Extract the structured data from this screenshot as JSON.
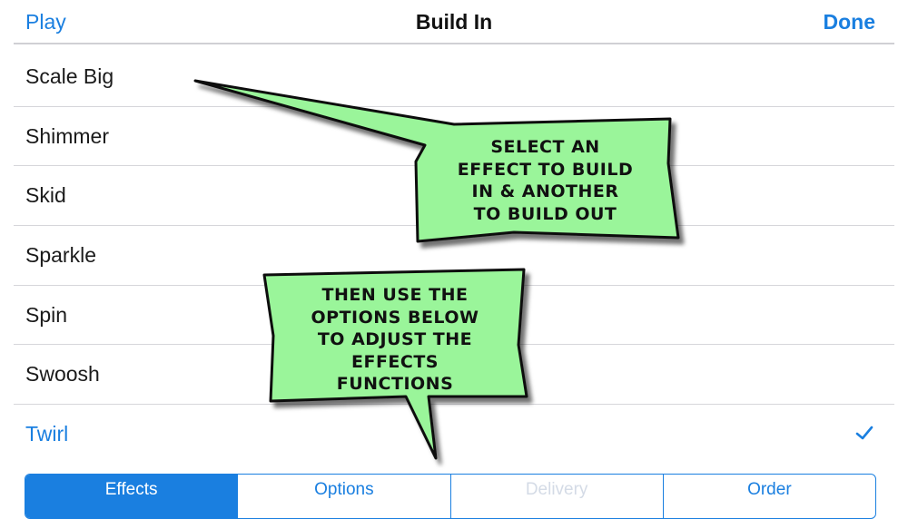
{
  "nav": {
    "left_label": "Play",
    "title": "Build In",
    "right_label": "Done"
  },
  "effects": [
    {
      "label": "Scale Big",
      "selected": false
    },
    {
      "label": "Shimmer",
      "selected": false
    },
    {
      "label": "Skid",
      "selected": false
    },
    {
      "label": "Sparkle",
      "selected": false
    },
    {
      "label": "Spin",
      "selected": false
    },
    {
      "label": "Swoosh",
      "selected": false
    },
    {
      "label": "Twirl",
      "selected": true
    }
  ],
  "tabs": [
    {
      "label": "Effects",
      "state": "active"
    },
    {
      "label": "Options",
      "state": "normal"
    },
    {
      "label": "Delivery",
      "state": "disabled"
    },
    {
      "label": "Order",
      "state": "normal"
    }
  ],
  "callouts": {
    "first": [
      "SELECT AN",
      "EFFECT TO BUILD",
      "IN & ANOTHER",
      "TO BUILD OUT"
    ],
    "second": [
      "THEN USE THE",
      "OPTIONS BELOW",
      "TO ADJUST THE",
      "EFFECTS",
      "FUNCTIONS"
    ]
  },
  "colors": {
    "accent": "#1a7fe0",
    "callout_fill": "#9af59a",
    "callout_stroke": "#111111"
  },
  "icons": {
    "selected_marker": "checkmark-icon"
  }
}
